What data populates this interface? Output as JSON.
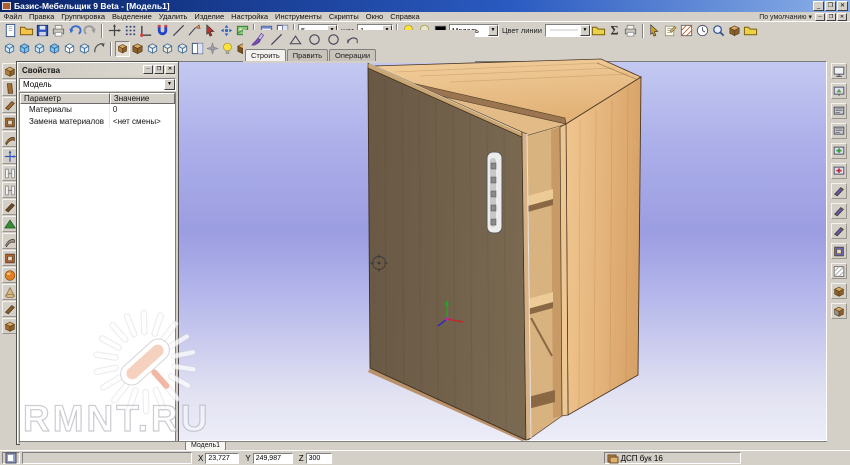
{
  "window": {
    "title": "Базис-Мебельщик 9 Beta - [Модель1]",
    "scheme": "По умолчанию",
    "minimize": "_",
    "restore": "❐",
    "close": "✕"
  },
  "menu": {
    "items": [
      "Файл",
      "Правка",
      "Группировка",
      "Выделение",
      "Удалить",
      "Изделие",
      "Настройка",
      "Инструменты",
      "Скрипты",
      "Окно",
      "Справка"
    ]
  },
  "toolbar1": {
    "file_icons": [
      {
        "n": "new-document-icon",
        "k": "page",
        "c": "#ffffff"
      },
      {
        "n": "open-folder-icon",
        "k": "folder",
        "c": "#f4c44a"
      },
      {
        "n": "save-icon",
        "k": "floppy",
        "c": "#2f55bb"
      },
      {
        "n": "print-icon",
        "k": "printer",
        "c": "#c9c6bf"
      },
      {
        "n": "undo-icon",
        "k": "undo",
        "c": "#3a6ad0"
      },
      {
        "n": "redo-icon",
        "k": "redo",
        "c": "#9a9a9a"
      }
    ],
    "draw_icons": [
      {
        "n": "axes-icon",
        "k": "axes",
        "c": "#444444"
      },
      {
        "n": "grid-icon",
        "k": "grid9",
        "c": "#3a4a80"
      },
      {
        "n": "snap-corner-icon",
        "k": "corner",
        "c": "#444444"
      },
      {
        "n": "magnet-icon",
        "k": "magnet",
        "c": "#2244cc"
      },
      {
        "n": "line-icon",
        "k": "line",
        "c": "#444455"
      },
      {
        "n": "polyline-icon",
        "k": "pline",
        "c": "#d09030"
      },
      {
        "n": "select-cursor-icon",
        "k": "cursor",
        "c": "#c03030"
      },
      {
        "n": "pan-view-icon",
        "k": "pan",
        "c": "#3060c0"
      },
      {
        "n": "render-view-icon",
        "k": "img",
        "c": "#8cc47a"
      }
    ],
    "view_icons": [
      {
        "n": "window-cascade-icon",
        "k": "win",
        "c": "#7288c8"
      },
      {
        "n": "text-window-icon",
        "k": "winA",
        "c": "#7288c8"
      }
    ],
    "step_value": "5",
    "step_label": "шаг",
    "step2_value": "1",
    "light_icons": [
      {
        "n": "light-on-icon",
        "k": "bulb",
        "c": "#ffe23a"
      },
      {
        "n": "light-off-icon",
        "k": "bulb",
        "c": "#e8e4d0"
      },
      {
        "n": "color-swatch-icon",
        "k": "swatch",
        "c": "#000000"
      }
    ],
    "mode_value": "Модель",
    "line_color_label": "Цвет линии",
    "tool_icons": [
      {
        "n": "material-icon",
        "k": "folder",
        "c": "#e8d24a"
      },
      {
        "n": "sum-icon",
        "k": "sigma",
        "c": "#333333"
      },
      {
        "n": "print2-icon",
        "k": "printer",
        "c": "#c9c6bf"
      }
    ],
    "edit_icons": [
      {
        "n": "select-tool-icon",
        "k": "cursor",
        "c": "#d0a020"
      },
      {
        "n": "note-icon",
        "k": "note",
        "c": "#d0b060"
      },
      {
        "n": "hatch-icon",
        "k": "hatch",
        "c": "#c06030"
      },
      {
        "n": "clock-icon",
        "k": "clock",
        "c": "#555577"
      },
      {
        "n": "search-icon",
        "k": "magnifier",
        "c": "#30508c"
      },
      {
        "n": "box-icon",
        "k": "cube",
        "c": "#8a5f2a"
      },
      {
        "n": "moon-icon",
        "k": "folder",
        "c": "#e8d24a"
      }
    ]
  },
  "toolbar2": {
    "wire_cubes": [
      {
        "n": "view-iso-icon",
        "k": "cubew",
        "c": "#cfe6f5"
      },
      {
        "n": "view-front-icon",
        "k": "cubew",
        "c": "#7ec4e8"
      },
      {
        "n": "view-side-icon",
        "k": "cubew",
        "c": "#cfe6f5"
      },
      {
        "n": "view-top-icon",
        "k": "cubew",
        "c": "#7ec4e8"
      },
      {
        "n": "view-back-icon",
        "k": "cubew",
        "c": "#ffffff"
      },
      {
        "n": "view-custom-icon",
        "k": "cubew",
        "c": "#e8e8e8"
      },
      {
        "n": "rotate-view-icon",
        "k": "arc",
        "c": "#555555"
      }
    ],
    "solid_cubes": [
      {
        "n": "shade-solid-icon",
        "k": "cube",
        "c": "#b5803f",
        "p": 1
      },
      {
        "n": "shade-texture-icon",
        "k": "cube",
        "c": "#8a5f2a"
      },
      {
        "n": "shade-wire-icon",
        "k": "cubew",
        "c": "#f0e8d8"
      },
      {
        "n": "shade-hidden-icon",
        "k": "cubew",
        "c": "#f0e8d8"
      },
      {
        "n": "shade-flat-icon",
        "k": "cubew",
        "c": "#f0e8d8"
      },
      {
        "n": "shade-gouraud-icon",
        "k": "winA",
        "c": "#e8ecf4"
      }
    ],
    "extra_icons": [
      {
        "n": "sparkle-icon",
        "k": "star",
        "c": "#9a9aa8"
      },
      {
        "n": "lamp-icon",
        "k": "bulb",
        "c": "#ffe23a"
      },
      {
        "n": "material-cube-icon",
        "k": "cube",
        "c": "#7a4f22"
      }
    ]
  },
  "sketch": {
    "icons": [
      {
        "n": "brush-icon",
        "k": "brush",
        "c": "#7a4fc0"
      },
      {
        "n": "segment-icon",
        "k": "line",
        "c": "#444455"
      },
      {
        "n": "angle-icon",
        "k": "angle",
        "c": "#444455"
      },
      {
        "n": "circle-icon",
        "k": "circle",
        "c": "#444455"
      },
      {
        "n": "circle2-icon",
        "k": "circle",
        "c": "#444455"
      },
      {
        "n": "arc-icon",
        "k": "arcm",
        "c": "#444455"
      }
    ],
    "tabs": [
      "Строить",
      "Править",
      "Операции"
    ]
  },
  "left_toolbar": [
    {
      "n": "panel-cube-icon",
      "k": "cube",
      "c": "#b5803f"
    },
    {
      "n": "panel-vertical-icon",
      "k": "boardv",
      "c": "#a06a30"
    },
    {
      "n": "panel-horizontal-icon",
      "k": "board",
      "c": "#a06a30"
    },
    {
      "n": "panel-frame-icon",
      "k": "frame",
      "c": "#a06a30"
    },
    {
      "n": "panel-bent-icon",
      "k": "bent",
      "c": "#a06a30"
    },
    {
      "n": "resize-icon",
      "k": "axes",
      "c": "#2a52c0"
    },
    {
      "n": "align-h-icon",
      "k": "hbar",
      "c": "#888888"
    },
    {
      "n": "align-v-icon",
      "k": "hbar",
      "c": "#888888"
    },
    {
      "n": "facade-icon",
      "k": "board",
      "c": "#6a4a28"
    },
    {
      "n": "roof-icon",
      "k": "tent",
      "c": "#3a8a3a"
    },
    {
      "n": "bend-sheet-icon",
      "k": "bent",
      "c": "#9a9aa8"
    },
    {
      "n": "rotate-panel-icon",
      "k": "frame",
      "c": "#b06030"
    },
    {
      "n": "sphere-icon",
      "k": "ball",
      "c": "#e08020"
    },
    {
      "n": "cone-icon",
      "k": "cone",
      "c": "#d8b880"
    },
    {
      "n": "angled-board-icon",
      "k": "board",
      "c": "#8a5f2a"
    },
    {
      "n": "grid-cube-icon",
      "k": "cube",
      "c": "#a06a30"
    }
  ],
  "right_toolbar": [
    {
      "n": "screen-white-icon",
      "k": "monitor",
      "c": "#f0f0f0"
    },
    {
      "n": "screen-green-icon",
      "k": "monitor2",
      "c": "#5aa04a"
    },
    {
      "n": "screen-list-icon",
      "k": "monitor3",
      "c": "#cccccc"
    },
    {
      "n": "screen-md-icon",
      "k": "monitor3",
      "c": "#cccccc"
    },
    {
      "n": "screen-plus-icon",
      "k": "monitor4",
      "c": "#30a030"
    },
    {
      "n": "screen-minus-icon",
      "k": "monitor4",
      "c": "#c03030"
    },
    {
      "n": "board-purple1-icon",
      "k": "board",
      "c": "#5a5aa8"
    },
    {
      "n": "board-purple2-icon",
      "k": "board",
      "c": "#5a5aa8"
    },
    {
      "n": "board-purple3-icon",
      "k": "board",
      "c": "#5a5aa8"
    },
    {
      "n": "board-framed-icon",
      "k": "frame",
      "c": "#6a6ab0"
    },
    {
      "n": "grid-gray-icon",
      "k": "hatch",
      "c": "#a0a0a0"
    },
    {
      "n": "cabinet-brown-icon",
      "k": "cube",
      "c": "#8a5f2a"
    },
    {
      "n": "cabinet-gray-icon",
      "k": "cube",
      "c": "#909090"
    }
  ],
  "properties": {
    "title": "Свойства",
    "combo_value": "Модель",
    "headers": [
      "Параметр",
      "Значение"
    ],
    "rows": [
      {
        "param": "Материалы",
        "value": "0"
      },
      {
        "param": "Замена материалов",
        "value": "<нет смены>"
      }
    ]
  },
  "document_tab": "Модель1",
  "statusbar": {
    "x_label": "X",
    "x": "23,727",
    "y_label": "Y",
    "y": "249,987",
    "z_label": "Z",
    "z": "300",
    "material": "ДСП бук 16"
  },
  "watermark": "RMNT.RU",
  "colors": {
    "door": "#6f5d46",
    "carcass": "#e8bc84",
    "viewport_top": "#c3c9f1",
    "viewport_mid": "#9b9de1"
  }
}
